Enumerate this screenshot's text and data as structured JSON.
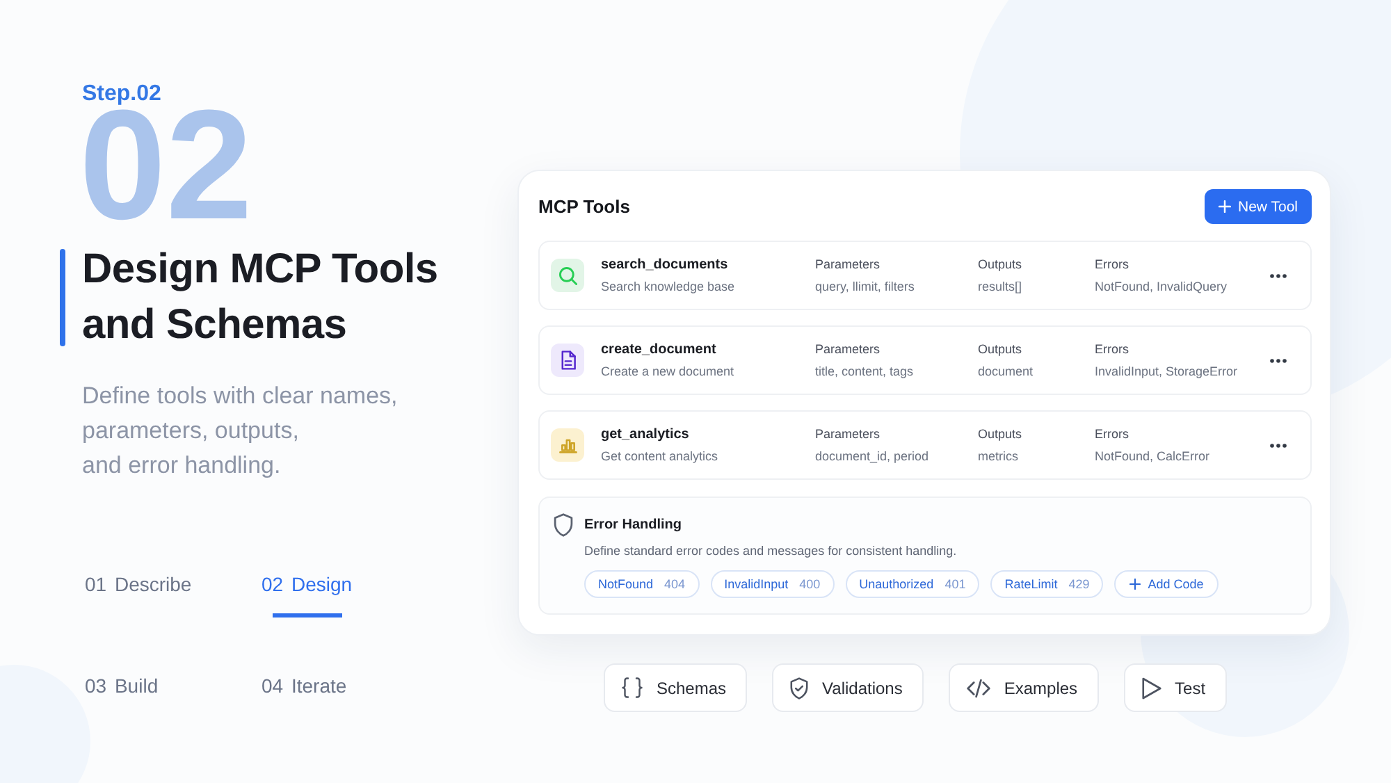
{
  "header": {
    "step_label": "Step.02",
    "step_number": "02",
    "title": "Design MCP Tools and Schemas",
    "description": "Define tools with clear names,\nparameters, outputs,\nand error handling."
  },
  "steps": [
    {
      "number": "01",
      "label": "Describe",
      "selected": false
    },
    {
      "number": "02",
      "label": "Design",
      "selected": true
    },
    {
      "number": "03",
      "label": "Build",
      "selected": false
    },
    {
      "number": "04",
      "label": "Iterate",
      "selected": false
    }
  ],
  "tools_panel": {
    "title": "MCP Tools",
    "new_button": "New Tool",
    "tools": [
      {
        "name": "search_documents",
        "description": "Search knowledge base",
        "color": "#e2f5e7",
        "fields": [
          {
            "label": "Parameters",
            "value": "query, llimit, filters"
          },
          {
            "label": "Outputs",
            "value": "results[]"
          },
          {
            "label": "Errors",
            "value": "NotFound, InvalidQuery"
          }
        ]
      },
      {
        "name": "create_document",
        "description": "Create a new document",
        "color": "#eee9fc",
        "fields": [
          {
            "label": "Parameters",
            "value": "title, content, tags"
          },
          {
            "label": "Outputs",
            "value": "document"
          },
          {
            "label": "Errors",
            "value": "InvalidInput, StorageError"
          }
        ]
      },
      {
        "name": "get_analytics",
        "description": "Get content analytics",
        "color": "#fcf1d0",
        "fields": [
          {
            "label": "Parameters",
            "value": "document_id, period"
          },
          {
            "label": "Outputs",
            "value": "metrics"
          },
          {
            "label": "Errors",
            "value": "NotFound, CalcError"
          }
        ]
      }
    ],
    "error_handling": {
      "title": "Error Handling",
      "description": "Define standard error codes and messages for consistent handling.",
      "codes": [
        {
          "name": "NotFound",
          "code": "404"
        },
        {
          "name": "InvalidInput",
          "code": "400"
        },
        {
          "name": "Unauthorized",
          "code": "401"
        },
        {
          "name": "RateLimit",
          "code": "429"
        }
      ],
      "add_button": "Add Code"
    }
  },
  "actions": [
    {
      "label": "Schemas"
    },
    {
      "label": "Validations"
    },
    {
      "label": "Examples"
    },
    {
      "label": "Test"
    }
  ]
}
